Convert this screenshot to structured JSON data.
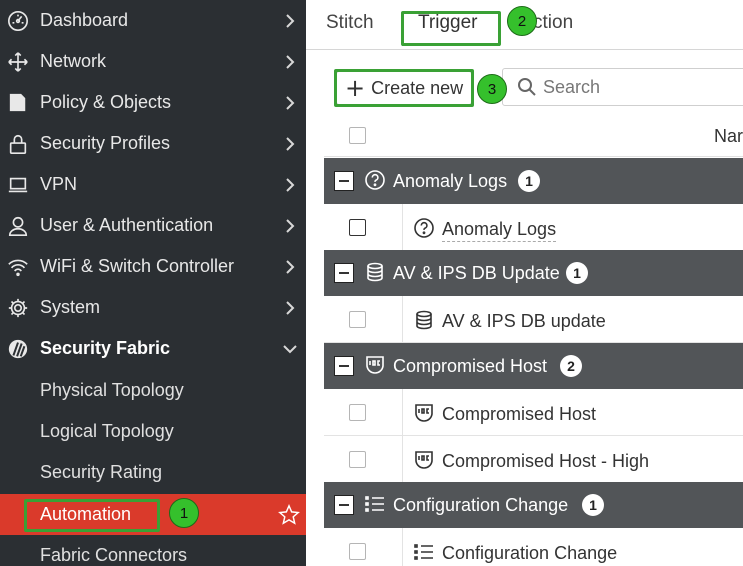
{
  "sidebar": {
    "items": [
      {
        "label": "Dashboard",
        "icon": "dashboard-icon"
      },
      {
        "label": "Network",
        "icon": "network-move-icon"
      },
      {
        "label": "Policy & Objects",
        "icon": "policy-icon"
      },
      {
        "label": "Security Profiles",
        "icon": "lock-icon"
      },
      {
        "label": "VPN",
        "icon": "laptop-icon"
      },
      {
        "label": "User & Authentication",
        "icon": "user-icon"
      },
      {
        "label": "WiFi & Switch Controller",
        "icon": "wifi-icon"
      },
      {
        "label": "System",
        "icon": "gear-icon"
      },
      {
        "label": "Security Fabric",
        "icon": "fabric-icon"
      }
    ],
    "sub_items": [
      {
        "label": "Physical Topology"
      },
      {
        "label": "Logical Topology"
      },
      {
        "label": "Security Rating"
      },
      {
        "label": "Automation"
      },
      {
        "label": "Fabric Connectors"
      }
    ],
    "active_color": "#da3a2b",
    "background": "#2b2f33"
  },
  "tabs": [
    {
      "label": "Stitch"
    },
    {
      "label": "Trigger"
    },
    {
      "label": "ction"
    }
  ],
  "toolbar": {
    "create_label": "Create new",
    "search_placeholder": "Search"
  },
  "table": {
    "header_name": "Nar",
    "groups": [
      {
        "label": "Anomaly Logs",
        "count": "1",
        "icon": "question-circle-icon",
        "items": [
          {
            "label": "Anomaly Logs",
            "icon": "question-circle-icon"
          }
        ]
      },
      {
        "label": "AV & IPS DB Update",
        "count": "1",
        "icon": "database-icon",
        "items": [
          {
            "label": "AV & IPS DB update",
            "icon": "database-icon"
          }
        ]
      },
      {
        "label": "Compromised Host",
        "count": "2",
        "icon": "ioc-shield-icon",
        "items": [
          {
            "label": "Compromised Host",
            "icon": "ioc-shield-icon"
          },
          {
            "label": "Compromised Host - High",
            "icon": "ioc-shield-icon"
          }
        ]
      },
      {
        "label": "Configuration Change",
        "count": "1",
        "icon": "list-icon",
        "items": [
          {
            "label": "Configuration Change",
            "icon": "list-icon"
          }
        ]
      }
    ]
  },
  "callouts": [
    "1",
    "2",
    "3"
  ],
  "colors": {
    "callout_green": "#35c02c",
    "tab_accent": "#2c7bb6",
    "group_row": "#525558"
  }
}
